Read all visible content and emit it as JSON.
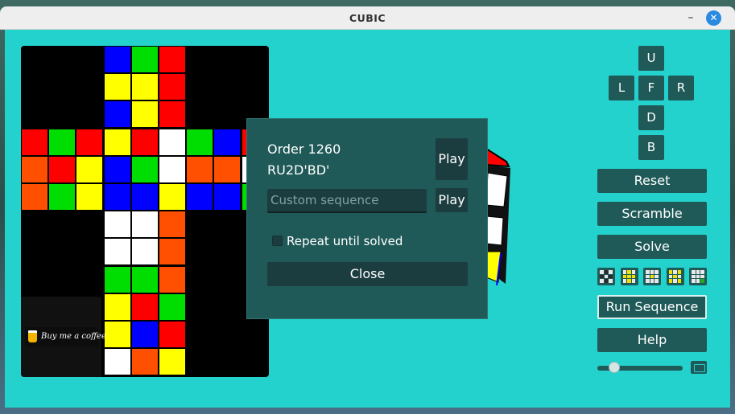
{
  "window": {
    "title": "CUBIC",
    "minimize_glyph": "–",
    "close_glyph": "✕"
  },
  "net": {
    "colors": {
      "B": "#0000ff",
      "G": "#00dd00",
      "R": "#ff0000",
      "Y": "#ffff00",
      "W": "#ffffff",
      "O": "#ff4f00"
    },
    "faces": [
      {
        "name": "top",
        "col": 3,
        "row": 0,
        "cells": [
          "B",
          "G",
          "R",
          "Y",
          "Y",
          "R",
          "B",
          "Y",
          "R"
        ]
      },
      {
        "name": "left",
        "col": 0,
        "row": 3,
        "cells": [
          "R",
          "G",
          "R",
          "O",
          "R",
          "Y",
          "O",
          "G",
          "Y"
        ]
      },
      {
        "name": "front",
        "col": 3,
        "row": 3,
        "cells": [
          "Y",
          "R",
          "W",
          "B",
          "G",
          "W",
          "B",
          "B",
          "Y"
        ]
      },
      {
        "name": "right",
        "col": 6,
        "row": 3,
        "cells": [
          "G",
          "B",
          "R",
          "O",
          "O",
          "W",
          "B",
          "B",
          "G"
        ]
      },
      {
        "name": "bottom",
        "col": 3,
        "row": 6,
        "cells": [
          "W",
          "W",
          "O",
          "W",
          "W",
          "O",
          "G",
          "G",
          "O"
        ]
      },
      {
        "name": "back",
        "col": 3,
        "row": 9,
        "cells": [
          "Y",
          "R",
          "G",
          "Y",
          "B",
          "R",
          "W",
          "O",
          "Y"
        ]
      }
    ]
  },
  "coffee": {
    "label": "Buy me a coffee"
  },
  "dialog": {
    "order": "Order 1260",
    "sequence": "RU2D'BD'",
    "play_label": "Play",
    "custom_placeholder": "Custom sequence",
    "repeat_label": "Repeat until solved",
    "repeat_checked": false,
    "close_label": "Close"
  },
  "controls": {
    "faces": [
      "U",
      "L",
      "F",
      "R",
      "D",
      "B"
    ],
    "reset": "Reset",
    "scramble": "Scramble",
    "solve": "Solve",
    "run_sequence": "Run Sequence",
    "help": "Help",
    "speed_fraction": 0.2,
    "patterns": [
      [
        "W",
        "B",
        "W",
        "B",
        "W",
        "B",
        "W",
        "B",
        "W"
      ],
      [
        "W",
        "Y",
        "W",
        "Y",
        "Y",
        "Y",
        "W",
        "Y",
        "W"
      ],
      [
        "W",
        "W",
        "W",
        "W",
        "Y",
        "W",
        "W",
        "W",
        "W"
      ],
      [
        "Y",
        "W",
        "Y",
        "W",
        "Y",
        "W",
        "Y",
        "W",
        "Y"
      ],
      [
        "W",
        "W",
        "W",
        "W",
        "W",
        "W",
        "W",
        "W",
        "G"
      ]
    ],
    "pattern_colors": {
      "W": "#e8e8e8",
      "B": "#2a2a2a",
      "Y": "#f0e000",
      "G": "#22aa22"
    }
  },
  "accent": "#23d2cc",
  "button_color": "#1f5a58"
}
